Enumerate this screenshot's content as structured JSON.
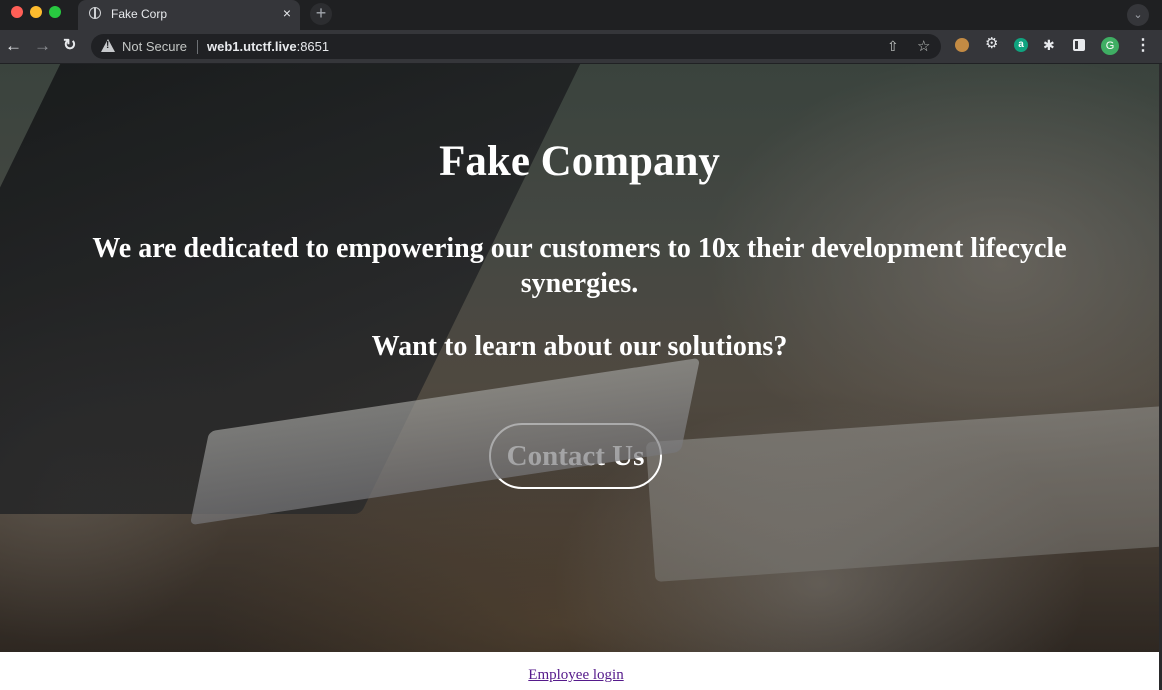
{
  "browser": {
    "tab_title": "Fake Corp",
    "tab_close": "×",
    "new_tab": "+",
    "security_label": "Not Secure",
    "url_host": "web1.utctf.live",
    "url_port": ":8651",
    "profile_initial": "G",
    "icons": [
      "globe-icon",
      "close-icon",
      "plus-icon",
      "chevron-down-icon",
      "back-arrow-icon",
      "forward-arrow-icon",
      "reload-icon",
      "warning-icon",
      "share-icon",
      "star-icon",
      "cookie-extension-icon",
      "gear-extension-icon",
      "a-extension-icon",
      "puzzle-icon",
      "side-panel-icon",
      "avatar",
      "kebab-menu-icon"
    ]
  },
  "hero": {
    "title": "Fake Company",
    "tagline": "We are dedicated to empowering our customers to 10x their development lifecycle synergies.",
    "question": "Want to learn about our solutions?",
    "cta_label": "Contact Us"
  },
  "footer": {
    "login_link": "Employee login"
  },
  "colors": {
    "chrome_bg": "#1f2022",
    "toolbar_bg": "#35363a",
    "omnibox_bg": "#202124",
    "hero_text": "#ffffff",
    "visited_link": "#551a8b"
  }
}
